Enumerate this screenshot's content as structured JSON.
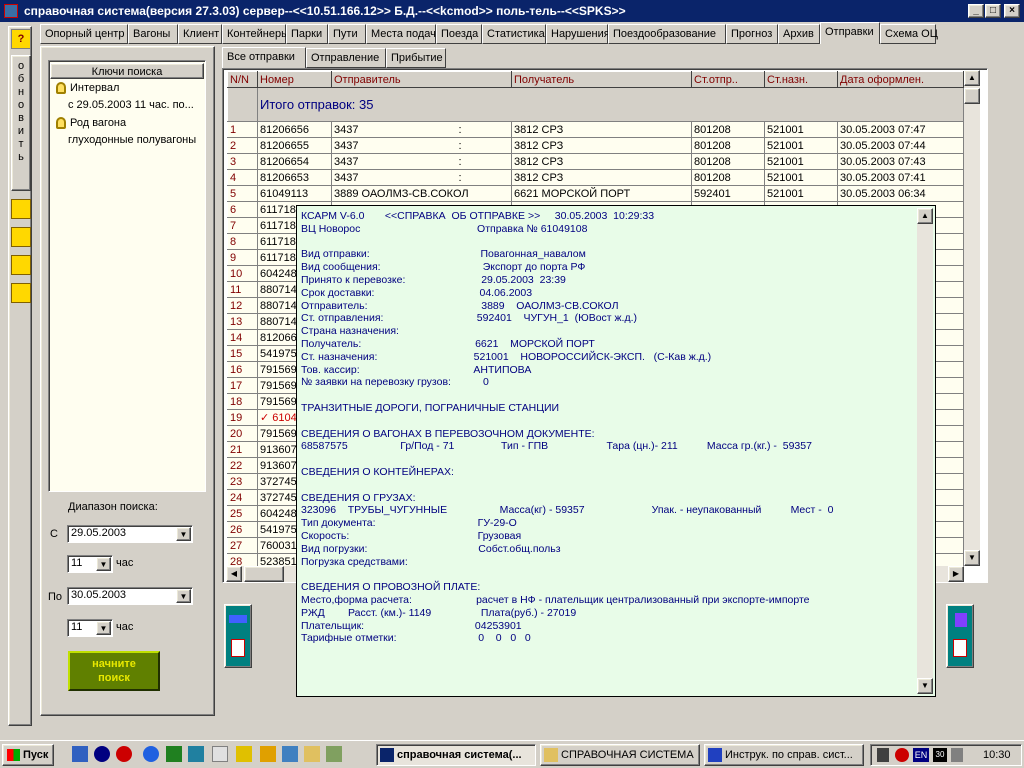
{
  "window": {
    "title": "справочная система(версия 27.3.03) сервер--<<10.51.166.12>> Б.Д.--<<kcmod>> поль-тель--<<SPKS>>",
    "min": "_",
    "max": "□",
    "close": "×"
  },
  "main_tabs": [
    {
      "label": "Опорный центр"
    },
    {
      "label": "Вагоны"
    },
    {
      "label": "Клиент"
    },
    {
      "label": "Контейнеры"
    },
    {
      "label": "Парки"
    },
    {
      "label": "Пути"
    },
    {
      "label": "Места подачи"
    },
    {
      "label": "Поезда"
    },
    {
      "label": "Статистика"
    },
    {
      "label": "Нарушения"
    },
    {
      "label": "Поездообразование"
    },
    {
      "label": "Прогноз"
    },
    {
      "label": "Архив"
    },
    {
      "label": "Отправки"
    },
    {
      "label": "Схема ОЦ"
    }
  ],
  "active_main_tab": "Отправки",
  "left_toolbar": {
    "help": "?",
    "refresh_letters": "о\nб\nн\nо\nв\nи\nт\nь"
  },
  "search_keys": {
    "header": "Ключи поиска",
    "items": [
      {
        "label": "Интервал",
        "value": "с 29.05.2003   11 час.  по..."
      },
      {
        "label": "Род вагона",
        "value": "глуходонные полувагоны"
      }
    ]
  },
  "range": {
    "title": "Диапазон поиска:",
    "from_label": "С",
    "from_date": "29.05.2003",
    "from_hour": "11",
    "hour_label": "час",
    "to_label": "По",
    "to_date": "30.05.2003",
    "to_hour": "11"
  },
  "start_search_button": "начните\nпоиск",
  "sub_tabs": [
    {
      "label": "Все отправки"
    },
    {
      "label": "Отправление"
    },
    {
      "label": "Прибытие"
    }
  ],
  "grid": {
    "headers": [
      "N/N",
      "Номер",
      "Отправитель",
      "Получатель",
      "Ст.отпр..",
      "Ст.назн.",
      "Дата оформлен."
    ],
    "total": "Итого отправок: 35",
    "rows": [
      [
        "1",
        "81206656",
        "3437",
        ":",
        "3812    СРЗ",
        "801208",
        "521001",
        "30.05.2003  07:47"
      ],
      [
        "2",
        "81206655",
        "3437",
        ":",
        "3812    СРЗ",
        "801208",
        "521001",
        "30.05.2003  07:44"
      ],
      [
        "3",
        "81206654",
        "3437",
        ":",
        "3812    СРЗ",
        "801208",
        "521001",
        "30.05.2003  07:43"
      ],
      [
        "4",
        "81206653",
        "3437",
        ":",
        "3812    СРЗ",
        "801208",
        "521001",
        "30.05.2003  07:41"
      ],
      [
        "5",
        "61049113",
        "3889    ОАОЛМЗ-СВ.СОКОЛ",
        "",
        "6621    МОРСКОЙ ПОРТ",
        "592401",
        "521001",
        "30.05.2003  06:34"
      ],
      [
        "6",
        "611718",
        "",
        "",
        "",
        "",
        "",
        ""
      ],
      [
        "7",
        "611718",
        "",
        "",
        "",
        "",
        "",
        ""
      ],
      [
        "8",
        "611718",
        "",
        "",
        "",
        "",
        "",
        ""
      ],
      [
        "9",
        "611718",
        "",
        "",
        "",
        "",
        "",
        ""
      ],
      [
        "10",
        "604248",
        "",
        "",
        "",
        "",
        "",
        ""
      ],
      [
        "11",
        "880714",
        "",
        "",
        "",
        "",
        "",
        ""
      ],
      [
        "12",
        "880714",
        "",
        "",
        "",
        "",
        "",
        ""
      ],
      [
        "13",
        "880714",
        "",
        "",
        "",
        "",
        "",
        ""
      ],
      [
        "14",
        "812066",
        "",
        "",
        "",
        "",
        "",
        ""
      ],
      [
        "15",
        "541975",
        "",
        "",
        "",
        "",
        "",
        ""
      ],
      [
        "16",
        "791569",
        "",
        "",
        "",
        "",
        "",
        ""
      ],
      [
        "17",
        "791569",
        "",
        "",
        "",
        "",
        "",
        ""
      ],
      [
        "18",
        "791569",
        "",
        "",
        "",
        "",
        "",
        ""
      ],
      [
        "19",
        "✓ 6104",
        "",
        "",
        "",
        "",
        "",
        ""
      ],
      [
        "20",
        "791569",
        "",
        "",
        "",
        "",
        "",
        ""
      ],
      [
        "21",
        "913607",
        "",
        "",
        "",
        "",
        "",
        ""
      ],
      [
        "22",
        "913607",
        "",
        "",
        "",
        "",
        "",
        ""
      ],
      [
        "23",
        "372745",
        "",
        "",
        "",
        "",
        "",
        ""
      ],
      [
        "24",
        "372745",
        "",
        "",
        "",
        "",
        "",
        ""
      ],
      [
        "25",
        "604248",
        "",
        "",
        "",
        "",
        "",
        ""
      ],
      [
        "26",
        "541975",
        "",
        "",
        "",
        "",
        "",
        ""
      ],
      [
        "27",
        "760031",
        "",
        "",
        "",
        "",
        "",
        ""
      ],
      [
        "28",
        "523851",
        "",
        "",
        "",
        "",
        "",
        ""
      ]
    ]
  },
  "popup_text": "КСАРМ V-6.0       <<СПРАВКА  ОБ ОТПРАВКЕ >>     30.05.2003  10:29:33\nВЦ Новорос                                        Отправка № 61049108\n\nВид отправки:                                      Повагонная_навалом\nВид сообщения:                                   Экспорт до порта РФ\nПринято к перевозке:                          29.05.2003  23:39\nСрок доставки:                                    04.06.2003\nОтправитель:                                       3889    ОАОЛМЗ-СВ.СОКОЛ\nСт. отправления:                                592401    ЧУГУН_1  (ЮВост ж.д.)\nСтрана назначения:\nПолучатель:                                       6621    МОРСКОЙ ПОРТ\nСт. назначения:                                 521001    НОВОРОССИЙСК-ЭКСП.   (С-Кав ж.д.)\nТов. кассир:                                       АНТИПОВА\n№ заявки на перевозку грузов:           0\n\nТРАНЗИТНЫЕ ДОРОГИ, ПОГРАНИЧНЫЕ СТАНЦИИ\n\nСВЕДЕНИЯ О ВАГОНАХ В ПЕРЕВОЗОЧНОМ ДОКУМЕНТЕ:\n68587575                  Гр/Под - 71                Тип - ГПВ                    Тара (цн.)- 211          Масса гр.(кг.) -  59357\n\nСВЕДЕНИЯ О КОНТЕЙНЕРАХ:\n\nСВЕДЕНИЯ О ГРУЗАХ:\n323096    ТРУБЫ_ЧУГУННЫЕ                  Масса(кг) - 59357                       Упак. - неупакованный          Мест -  0\nТип документа:                                   ГУ-29-О\nСкорость:                                            Грузовая\nВид погрузки:                                      Собст.общ.польз\nПогрузка средствами:\n\nСВЕДЕНИЯ О ПРОВОЗНОЙ ПЛАТЕ:\nМесто,форма расчета:                      расчет в НФ - плательщик централизованный при экспорте-импорте\nРЖД        Расст. (км.)- 1149                 Плата(руб.) - 27019\nПлательщик:                                      04253901\nТарифные отметки:                            0    0   0   0",
  "taskbar": {
    "start": "Пуск",
    "tasks": [
      {
        "label": "справочная система(..."
      },
      {
        "label": "СПРАВОЧНАЯ СИСТЕМА"
      },
      {
        "label": "Инструк. по справ. сист..."
      }
    ],
    "lang": "EN",
    "clock": "10:30"
  },
  "colors": {
    "title_bg": "#0a246a",
    "grid_bg": "#fffef0",
    "popup_bg": "#e8fce8",
    "popup_text": "#000080",
    "header_text": "#800000",
    "go_button": "#608000"
  }
}
